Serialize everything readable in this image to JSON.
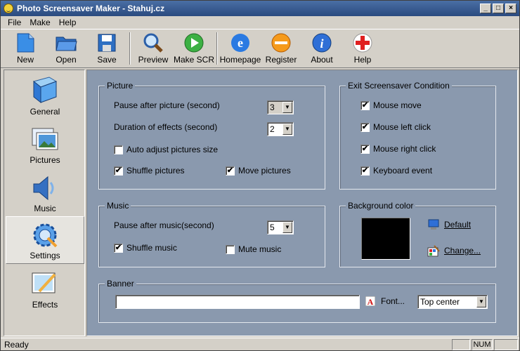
{
  "window": {
    "title": "Photo Screensaver Maker - Stahuj.cz",
    "minimize": "_",
    "maximize": "□",
    "close": "×"
  },
  "menu": [
    "File",
    "Make",
    "Help"
  ],
  "toolbar": {
    "new": "New",
    "open": "Open",
    "save": "Save",
    "preview": "Preview",
    "make_scr": "Make SCR",
    "homepage": "Homepage",
    "register": "Register",
    "about": "About",
    "help": "Help"
  },
  "sidebar": {
    "general": "General",
    "pictures": "Pictures",
    "music": "Music",
    "settings": "Settings",
    "effects": "Effects",
    "active": "Settings"
  },
  "picture": {
    "legend": "Picture",
    "pause_label": "Pause after picture (second)",
    "pause_value": "3",
    "duration_label": "Duration of effects (second)",
    "duration_value": "2",
    "auto_adjust": "Auto adjust pictures size",
    "auto_adjust_checked": false,
    "shuffle": "Shuffle pictures",
    "shuffle_checked": true,
    "move": "Move pictures",
    "move_checked": true
  },
  "exit": {
    "legend": "Exit Screensaver Condition",
    "mouse_move": "Mouse move",
    "mouse_move_checked": true,
    "mouse_left": "Mouse left click",
    "mouse_left_checked": true,
    "mouse_right": "Mouse right click",
    "mouse_right_checked": true,
    "keyboard": "Keyboard event",
    "keyboard_checked": true
  },
  "music": {
    "legend": "Music",
    "pause_label": "Pause after music(second)",
    "pause_value": "5",
    "shuffle": "Shuffle music",
    "shuffle_checked": true,
    "mute": "Mute music",
    "mute_checked": false
  },
  "background": {
    "legend": "Background color",
    "color": "#000000",
    "default": "Default",
    "change": "Change..."
  },
  "banner": {
    "legend": "Banner",
    "text": "",
    "font": "Font...",
    "position": "Top center"
  },
  "status": {
    "message": "Ready",
    "num": "NUM"
  },
  "checkmark": "✔"
}
